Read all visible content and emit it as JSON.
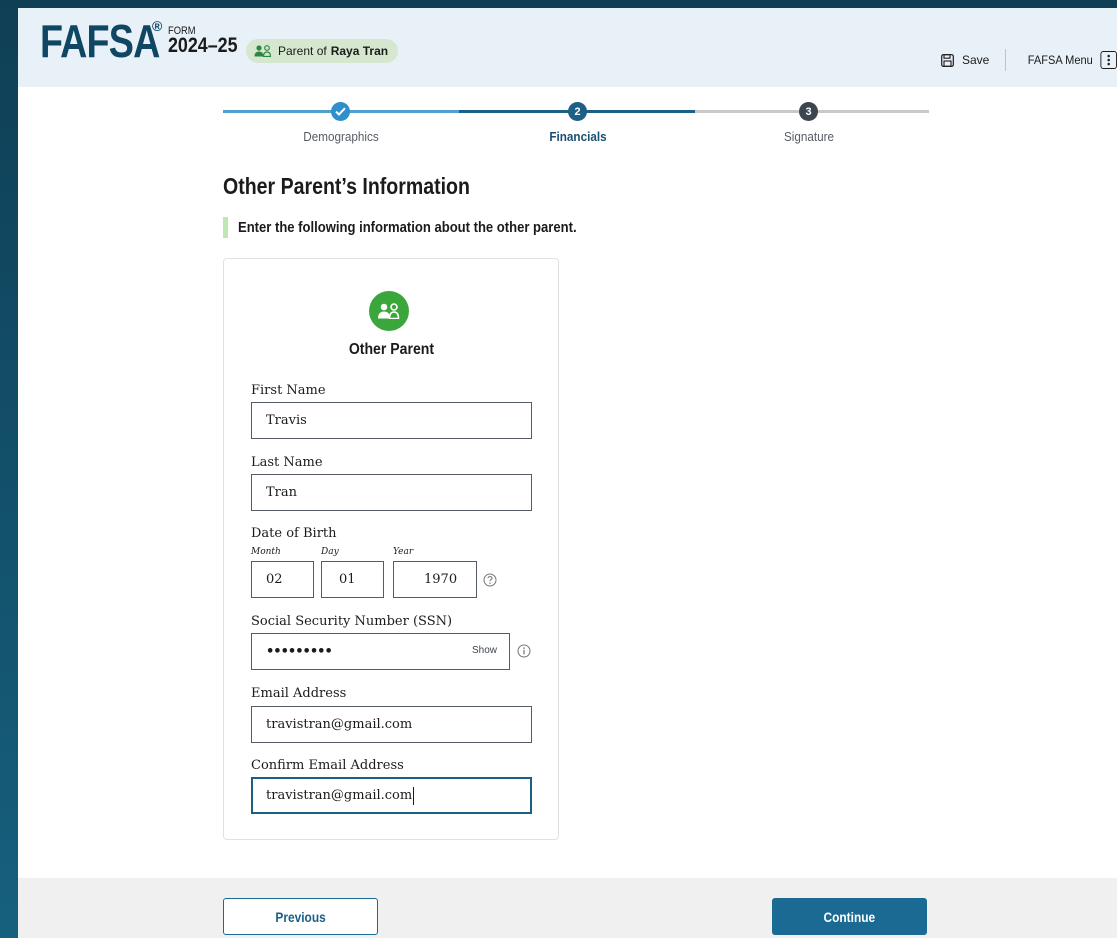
{
  "header": {
    "logo_text": "FAFSA",
    "logo_reg": "®",
    "form_label": "FORM",
    "form_year": "2024–25",
    "role_prefix": "Parent of",
    "role_name": "Raya Tran",
    "save_label": "Save",
    "menu_label": "FAFSA Menu"
  },
  "progress": {
    "steps": [
      {
        "number": "1",
        "label": "Demographics",
        "state": "complete"
      },
      {
        "number": "2",
        "label": "Financials",
        "state": "current"
      },
      {
        "number": "3",
        "label": "Signature",
        "state": "upcoming"
      }
    ]
  },
  "page": {
    "title": "Other Parent’s Information",
    "intro": "Enter the following information about the other parent."
  },
  "card": {
    "title": "Other Parent",
    "first_name": {
      "label": "First Name",
      "value": "Travis"
    },
    "last_name": {
      "label": "Last Name",
      "value": "Tran"
    },
    "dob": {
      "label": "Date of Birth",
      "month_label": "Month",
      "month": "02",
      "day_label": "Day",
      "day": "01",
      "year_label": "Year",
      "year": "1970"
    },
    "ssn": {
      "label": "Social Security Number (SSN)",
      "masked": "•••••••••",
      "show_label": "Show"
    },
    "email": {
      "label": "Email Address",
      "value": "travistran@gmail.com"
    },
    "confirm_email": {
      "label": "Confirm Email Address",
      "value": "travistran@gmail.com"
    }
  },
  "footer": {
    "previous_label": "Previous",
    "continue_label": "Continue"
  },
  "colors": {
    "brand": "#0e4663",
    "accent": "#1a6a93",
    "success": "#3aa63b",
    "header_bg": "#e8f1f8"
  }
}
